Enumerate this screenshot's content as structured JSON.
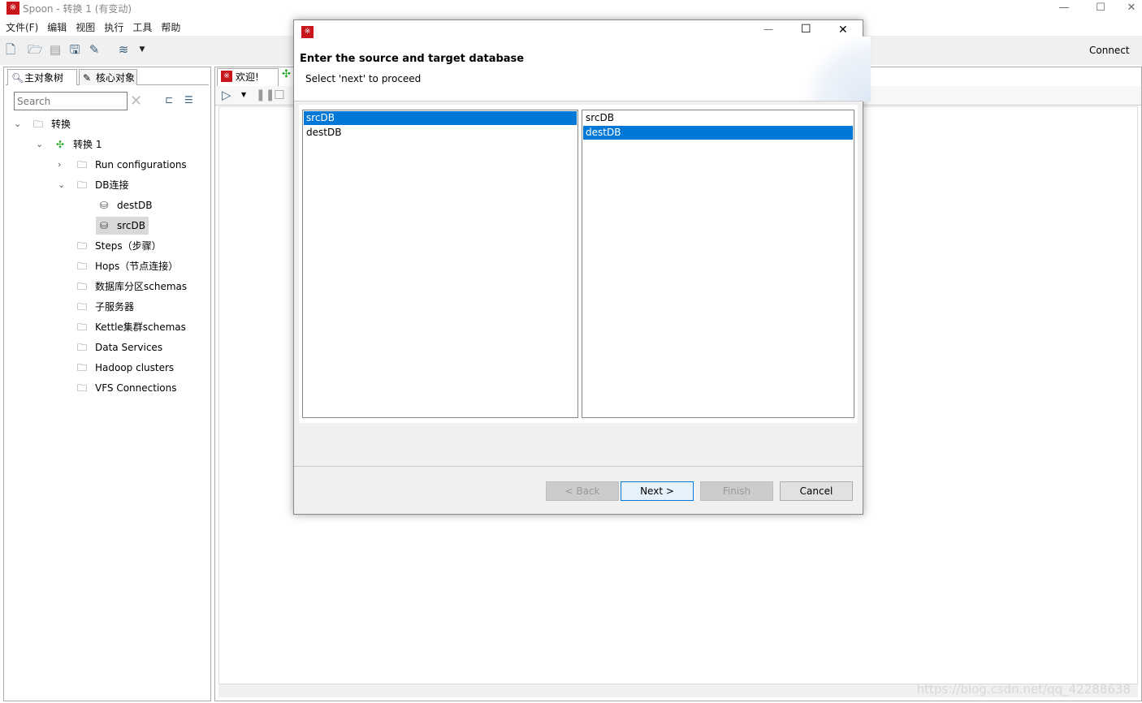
{
  "window": {
    "title": "Spoon - 转换 1 (有变动)",
    "minimize": "—",
    "maximize": "☐",
    "close": "✕"
  },
  "menu": [
    "文件(F)",
    "编辑",
    "视图",
    "执行",
    "工具",
    "帮助"
  ],
  "toolbar": {
    "connect_label": "Connect"
  },
  "left_panel": {
    "tabs": [
      "主对象树",
      "核心对象"
    ],
    "search_placeholder": "Search",
    "tree": [
      {
        "label": "转换",
        "icon": "folder-icon",
        "level": 0,
        "expanded": true
      },
      {
        "label": "转换 1",
        "icon": "transformation-icon",
        "level": 1,
        "expanded": true
      },
      {
        "label": "Run configurations",
        "icon": "folder-icon",
        "level": 2,
        "expanded": false
      },
      {
        "label": "DB连接",
        "icon": "folder-icon",
        "level": 2,
        "expanded": true
      },
      {
        "label": "destDB",
        "icon": "database-icon",
        "level": 3
      },
      {
        "label": "srcDB",
        "icon": "database-icon",
        "level": 3,
        "selected": true
      },
      {
        "label": "Steps（步骤）",
        "icon": "folder-icon",
        "level": 2
      },
      {
        "label": "Hops（节点连接）",
        "icon": "folder-icon",
        "level": 2
      },
      {
        "label": "数据库分区schemas",
        "icon": "folder-icon",
        "level": 2
      },
      {
        "label": "子服务器",
        "icon": "folder-icon",
        "level": 2
      },
      {
        "label": "Kettle集群schemas",
        "icon": "folder-icon",
        "level": 2
      },
      {
        "label": "Data Services",
        "icon": "folder-icon",
        "level": 2
      },
      {
        "label": "Hadoop clusters",
        "icon": "folder-icon",
        "level": 2
      },
      {
        "label": "VFS Connections",
        "icon": "folder-icon",
        "level": 2
      }
    ]
  },
  "editor": {
    "tabs": [
      "欢迎!"
    ]
  },
  "dialog": {
    "heading": "Enter the source and target database",
    "subheading": "Select 'next' to proceed",
    "source_list": {
      "items": [
        "srcDB",
        "destDB"
      ],
      "selected": "srcDB"
    },
    "target_list": {
      "items": [
        "srcDB",
        "destDB"
      ],
      "selected": "destDB"
    },
    "buttons": {
      "back": "< Back",
      "next": "Next >",
      "finish": "Finish",
      "cancel": "Cancel"
    },
    "close": "✕",
    "maximize": "☐",
    "minimize": "—"
  },
  "watermark": "https://blog.csdn.net/qq_42288638",
  "colors": {
    "selection": "#0078d7",
    "brand": "#c8161d"
  }
}
